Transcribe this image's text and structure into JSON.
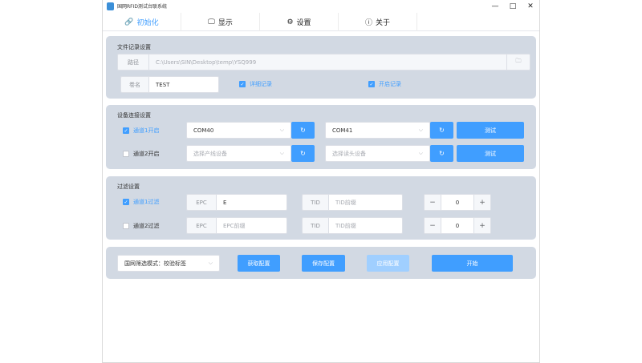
{
  "window": {
    "title": "国网RFID测试台联系统",
    "minimize": "—",
    "maximize": "□",
    "close": "✕"
  },
  "tabs": [
    {
      "icon": "🔗",
      "label": "初始化"
    },
    {
      "icon": "🖵",
      "label": "显示"
    },
    {
      "icon": "⚙",
      "label": "设置"
    },
    {
      "icon": "ⓘ",
      "label": "关于"
    }
  ],
  "log": {
    "title": "文件记录设置",
    "path_label": "路径",
    "path_value": "C:\\Users\\SIN\\Desktop\\temp\\YSQ999",
    "folder_icon": "🗀",
    "name_label": "卷名",
    "name_value": "TEST",
    "detail_label": "详细记录",
    "open_label": "开启记录"
  },
  "device": {
    "title": "设备连接设置",
    "ch1_label": "通道1开启",
    "ch2_label": "通道2开启",
    "ch1_port_a": "COM40",
    "ch1_port_b": "COM41",
    "ch2_placeholder_a": "选择产线设备",
    "ch2_placeholder_b": "选择读头设备",
    "refresh": "↻",
    "test_label": "测试"
  },
  "filter": {
    "title": "过滤设置",
    "ch1_label": "通道1过滤",
    "ch2_label": "通道2过滤",
    "epc": "EPC",
    "tid": "TID",
    "ch1_epc_value": "E",
    "ch2_epc_placeholder": "EPC前缀",
    "tid_placeholder": "TID前缀",
    "minus": "−",
    "plus": "+",
    "ch1_count": "0",
    "ch2_count": "0"
  },
  "actions": {
    "mode_label": "国网筛选模式：校验标签",
    "get_config": "获取配置",
    "save_config": "保存配置",
    "apply_config": "应用配置",
    "start": "开始"
  },
  "colors": {
    "accent": "#409eff",
    "panel": "#d2d9e3",
    "disabled": "#a0cfff"
  }
}
